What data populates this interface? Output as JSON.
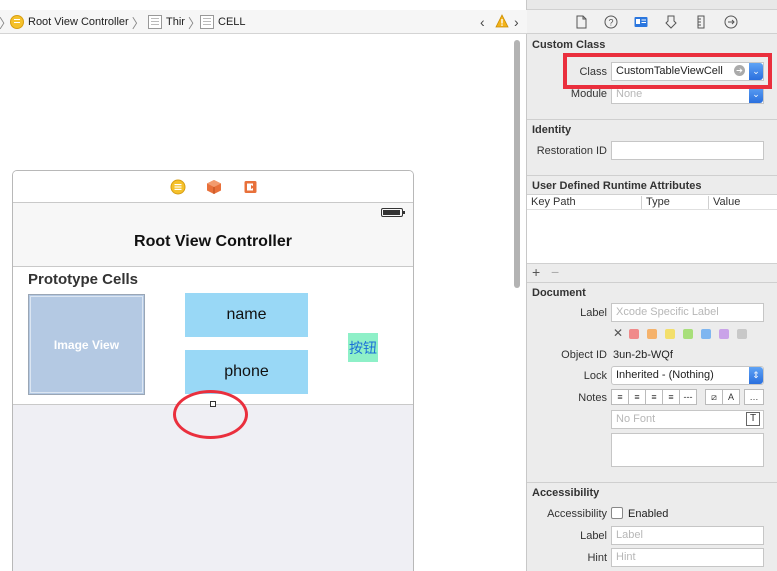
{
  "breadcrumb": {
    "items": [
      "Root View Controller",
      "Thir",
      "CELL"
    ]
  },
  "scene": {
    "nav_title": "Root View Controller",
    "prototype_header": "Prototype Cells",
    "image_view_label": "Image View",
    "name_label": "name",
    "phone_label": "phone",
    "button_label": "按钮"
  },
  "inspector": {
    "custom_class": {
      "title": "Custom Class",
      "class_label": "Class",
      "class_value": "CustomTableViewCell",
      "module_label": "Module",
      "module_placeholder": "None"
    },
    "identity": {
      "title": "Identity",
      "restoration_label": "Restoration ID",
      "restoration_value": ""
    },
    "runtime_attrs": {
      "title": "User Defined Runtime Attributes",
      "columns": [
        "Key Path",
        "Type",
        "Value"
      ],
      "add": "+",
      "remove": "−"
    },
    "document": {
      "title": "Document",
      "label_label": "Label",
      "label_placeholder": "Xcode Specific Label",
      "object_id_label": "Object ID",
      "object_id_value": "3un-2b-WQf",
      "lock_label": "Lock",
      "lock_value": "Inherited - (Nothing)",
      "notes_label": "Notes",
      "font_placeholder": "No Font",
      "label_colors": [
        "#f08a8a",
        "#f5b26b",
        "#f3df6b",
        "#a8df7a",
        "#7fb6f0",
        "#c9a3e8",
        "#c8c8c8"
      ]
    },
    "accessibility": {
      "title": "Accessibility",
      "accessibility_label": "Accessibility",
      "enabled_label": "Enabled",
      "label_label": "Label",
      "label_placeholder": "Label",
      "hint_label": "Hint",
      "hint_placeholder": "Hint"
    }
  }
}
